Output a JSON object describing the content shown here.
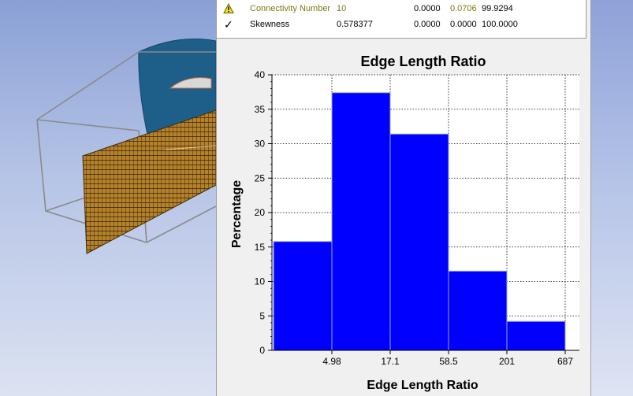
{
  "mesh_stats": {
    "rows": [
      {
        "status_icon": "warning-icon",
        "name": "Connectivity Number",
        "value": "10",
        "c1": "0.0000",
        "c2": "0.0706",
        "c3": "99.9294",
        "highlight": true
      },
      {
        "status_icon": "check-icon",
        "name": "Skewness",
        "value": "0.578377",
        "c1": "0.0000",
        "c2": "0.0000",
        "c3": "100.0000",
        "highlight": false
      }
    ]
  },
  "chart_data": {
    "type": "bar",
    "title": "Edge Length Ratio",
    "xlabel": "Edge Length Ratio",
    "ylabel": "Percentage",
    "ylim": [
      0,
      40
    ],
    "yticks": [
      0,
      5,
      10,
      15,
      20,
      25,
      30,
      35,
      40
    ],
    "xtick_labels": [
      "4.98",
      "17.1",
      "58.5",
      "201",
      "687"
    ],
    "values": [
      15.8,
      37.4,
      31.4,
      11.5,
      4.2
    ],
    "grid": true,
    "bar_color": "#0000ff"
  },
  "colors": {
    "viewport_top": "#8aa0d6",
    "mesh_fill": "#b5812a",
    "body_blue": "#1e5f8a",
    "bar": "#0000ff"
  }
}
